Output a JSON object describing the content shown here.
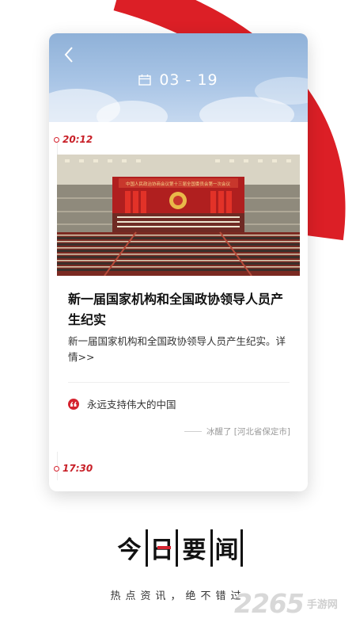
{
  "header": {
    "date": "03 - 19"
  },
  "timeline": [
    {
      "time": "20:12"
    },
    {
      "time": "17:30"
    }
  ],
  "news": {
    "title": "新一届国家机构和全国政协领导人员产生纪实",
    "summary": "新一届国家机构和全国政协领导人员产生纪实。",
    "more": "详情>>",
    "comment": "永远支持伟大的中国",
    "byline": "冰醒了 [河北省保定市]"
  },
  "brand": {
    "chars": [
      "今",
      "日",
      "要",
      "闻"
    ],
    "slogan": "热点资讯，绝不错过"
  },
  "watermark": {
    "number": "2265",
    "text": "手游网"
  },
  "colors": {
    "accent": "#d5232f",
    "header_sky": "#9ebde2"
  }
}
